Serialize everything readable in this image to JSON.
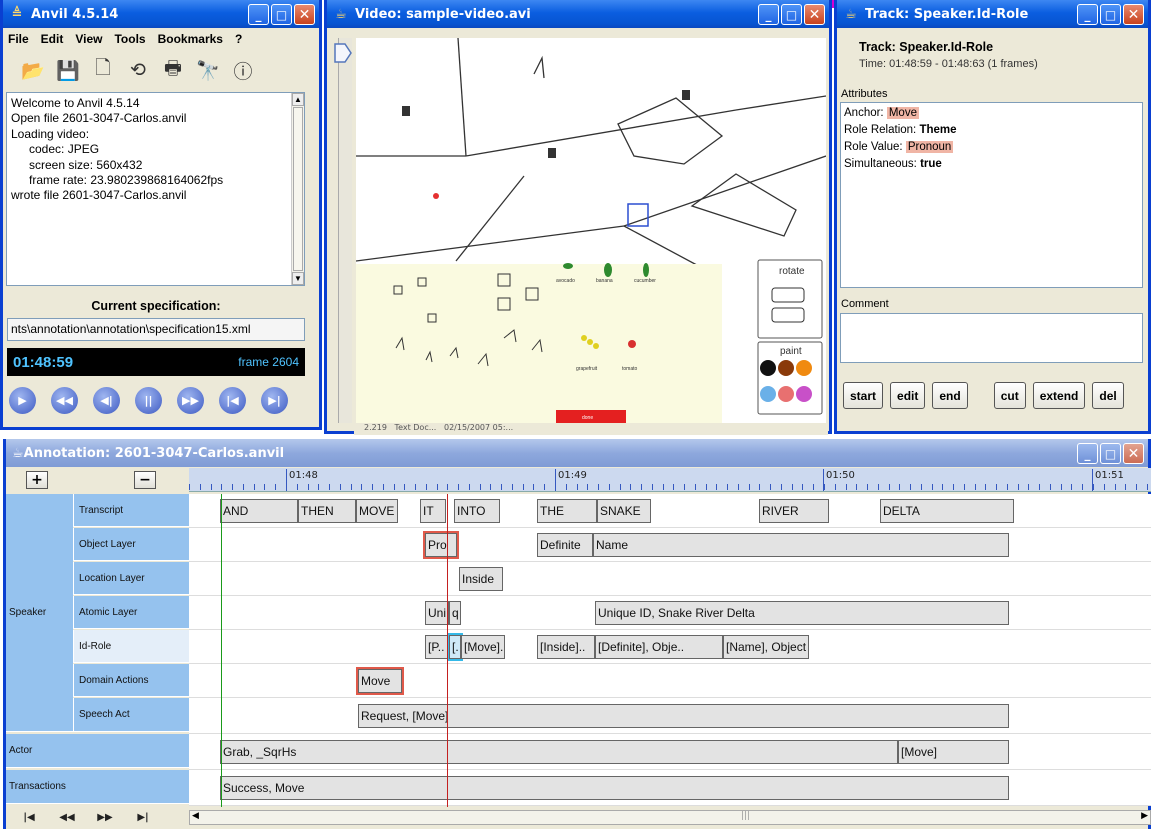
{
  "anvil": {
    "title": "Anvil 4.5.14",
    "menu": [
      "File",
      "Edit",
      "View",
      "Tools",
      "Bookmarks",
      "?"
    ],
    "log": [
      "Welcome to Anvil 4.5.14",
      "Open file 2601-3047-Carlos.anvil",
      "Loading video:",
      "codec: JPEG",
      "screen size: 560x432",
      "frame rate: 23.980239868164062fps",
      "wrote file 2601-3047-Carlos.anvil"
    ],
    "spec_label": "Current specification:",
    "spec_path": "nts\\annotation\\annotation\\specification15.xml",
    "timecode": "01:48:59",
    "frame": "frame 2604"
  },
  "video": {
    "title": "Video: sample-video.avi",
    "panel_rotate": "rotate",
    "panel_paint": "paint",
    "labels": [
      "avocado",
      "banana",
      "cucumber",
      "grapefruit",
      "tomato"
    ],
    "done_label": "done",
    "status_fragments": [
      "2.219",
      "Text Doc...",
      "02/15/2007 05:..."
    ]
  },
  "track": {
    "title": "Track: Speaker.Id-Role",
    "heading": "Track: Speaker.Id-Role",
    "time": "Time: 01:48:59 - 01:48:63 (1 frames)",
    "attributes_label": "Attributes",
    "attributes": [
      {
        "key": "Anchor:",
        "value": "Move",
        "style": "hl"
      },
      {
        "key": "Role Relation:",
        "value": "Theme",
        "style": "bold"
      },
      {
        "key": "Role Value:",
        "value": "Pronoun",
        "style": "hl"
      },
      {
        "key": "Simultaneous:",
        "value": "true",
        "style": "bold"
      }
    ],
    "comment_label": "Comment",
    "buttons": [
      "start",
      "edit",
      "end",
      "cut",
      "extend",
      "del"
    ]
  },
  "annotation": {
    "title": "Annotation: 2601-3047-Carlos.anvil",
    "ruler_labels": [
      "01:48",
      "01:49",
      "01:50",
      "01:51"
    ],
    "groups": {
      "speaker": "Speaker",
      "actor": "Actor",
      "transactions": "Transactions"
    },
    "tracks": [
      "Transcript",
      "Object Layer",
      "Location Layer",
      "Atomic Layer",
      "Id-Role",
      "Domain Actions",
      "Speech Act"
    ],
    "segments": {
      "transcript": [
        "AND",
        "THEN",
        "MOVE",
        "IT",
        "INTO",
        "THE",
        "SNAKE",
        "RIVER",
        "DELTA"
      ],
      "object": [
        "Pro",
        "Definite",
        "Name"
      ],
      "location": [
        "Inside"
      ],
      "atomic": [
        "Uni",
        "q",
        "Unique ID, Snake River Delta"
      ],
      "idrole": [
        "[P..",
        "[.",
        "[Move]..",
        "[Inside]..",
        "[Definite], Obje..",
        "[Name], Object Re.."
      ],
      "domain": [
        "Move"
      ],
      "speech": [
        "Request, [Move]"
      ],
      "actor": [
        "Grab, _SqrHs",
        "[Move]"
      ],
      "transactions": [
        "Success, Move"
      ]
    }
  },
  "colors": {
    "xp_blue": "#0a3fd1",
    "track_label": "#95c2ee",
    "highlight": "#f0b5a5"
  }
}
